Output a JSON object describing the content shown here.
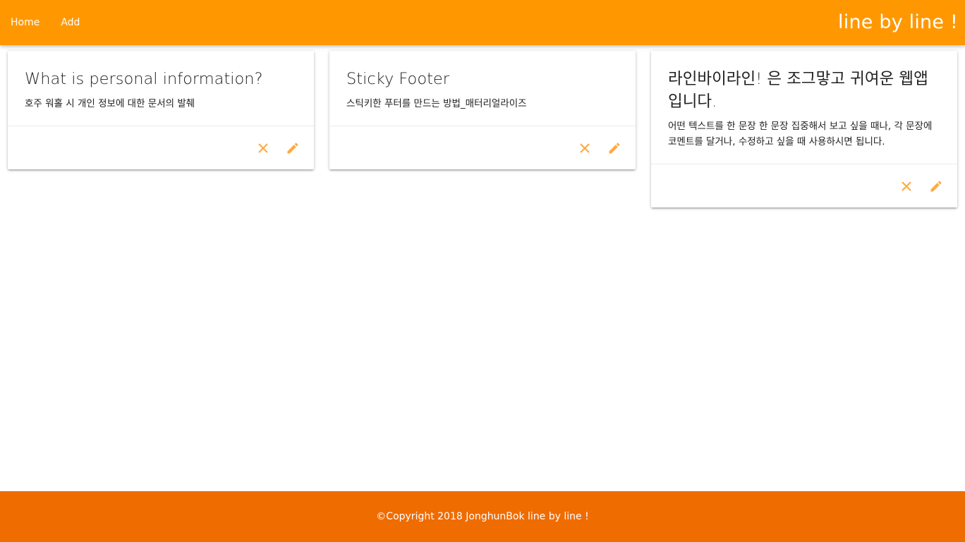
{
  "nav": {
    "links": [
      "Home",
      "Add"
    ],
    "brand": "line by line !"
  },
  "cards": [
    {
      "title": "What is personal information?",
      "text": "호주 워홀 시 개인 정보에 대한 문서의 발췌",
      "actions": {
        "delete_icon": "close-icon",
        "edit_icon": "pencil-icon"
      }
    },
    {
      "title": "Sticky Footer",
      "text": "스틱키한 푸터를 만드는 방법_매터리얼라이즈",
      "actions": {
        "delete_icon": "close-icon",
        "edit_icon": "pencil-icon"
      }
    },
    {
      "title": "라인바이라인! 은 조그맣고 귀여운 웹앱 입니다.",
      "text": "어떤 텍스트를 한 문장 한 문장 집중해서 보고 싶을 때나, 각 문장에 코멘트를 달거나, 수정하고 싶을 때 사용하시면 됩니다.",
      "actions": {
        "delete_icon": "close-icon",
        "edit_icon": "pencil-icon"
      }
    }
  ],
  "footer": {
    "text": "©Copyright 2018 JonghunBok line by line !"
  },
  "colors": {
    "navbar": "#ff9800",
    "footer": "#ef6c00",
    "action_icon": "#ffab40"
  }
}
